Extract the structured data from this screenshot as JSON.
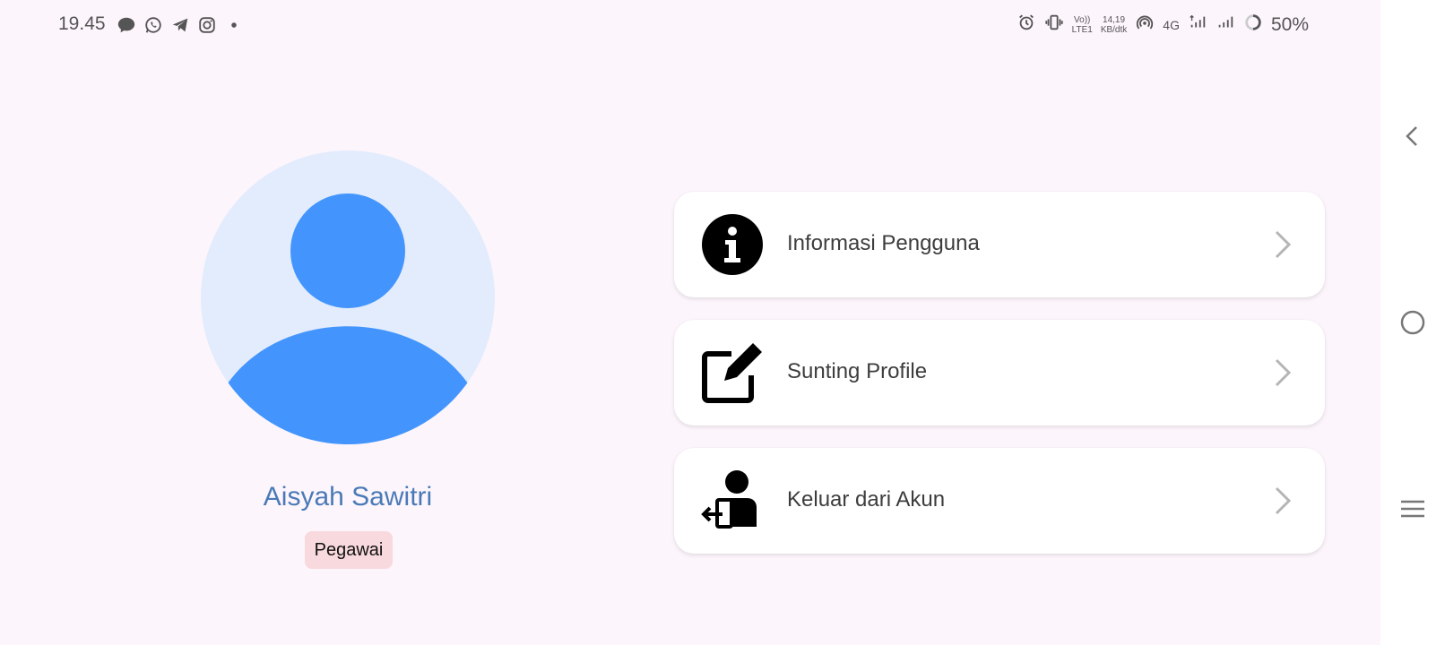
{
  "status_bar": {
    "time": "19.45",
    "network_speed_value": "14,19",
    "network_speed_unit": "KB/dtk",
    "volte_top": "Vo))",
    "volte_bottom": "LTE1",
    "network_type": "4G",
    "battery": "50%"
  },
  "profile": {
    "name": "Aisyah Sawitri",
    "role": "Pegawai"
  },
  "menu": {
    "items": [
      {
        "label": "Informasi Pengguna",
        "icon": "info-icon"
      },
      {
        "label": "Sunting Profile",
        "icon": "edit-icon"
      },
      {
        "label": "Keluar dari Akun",
        "icon": "logout-user-icon"
      }
    ]
  },
  "colors": {
    "background": "#fdf5fc",
    "avatar_bg": "#e3ecfc",
    "avatar_fg": "#4395fd",
    "name": "#4a7ab6",
    "badge_bg": "#f8d9dd"
  }
}
